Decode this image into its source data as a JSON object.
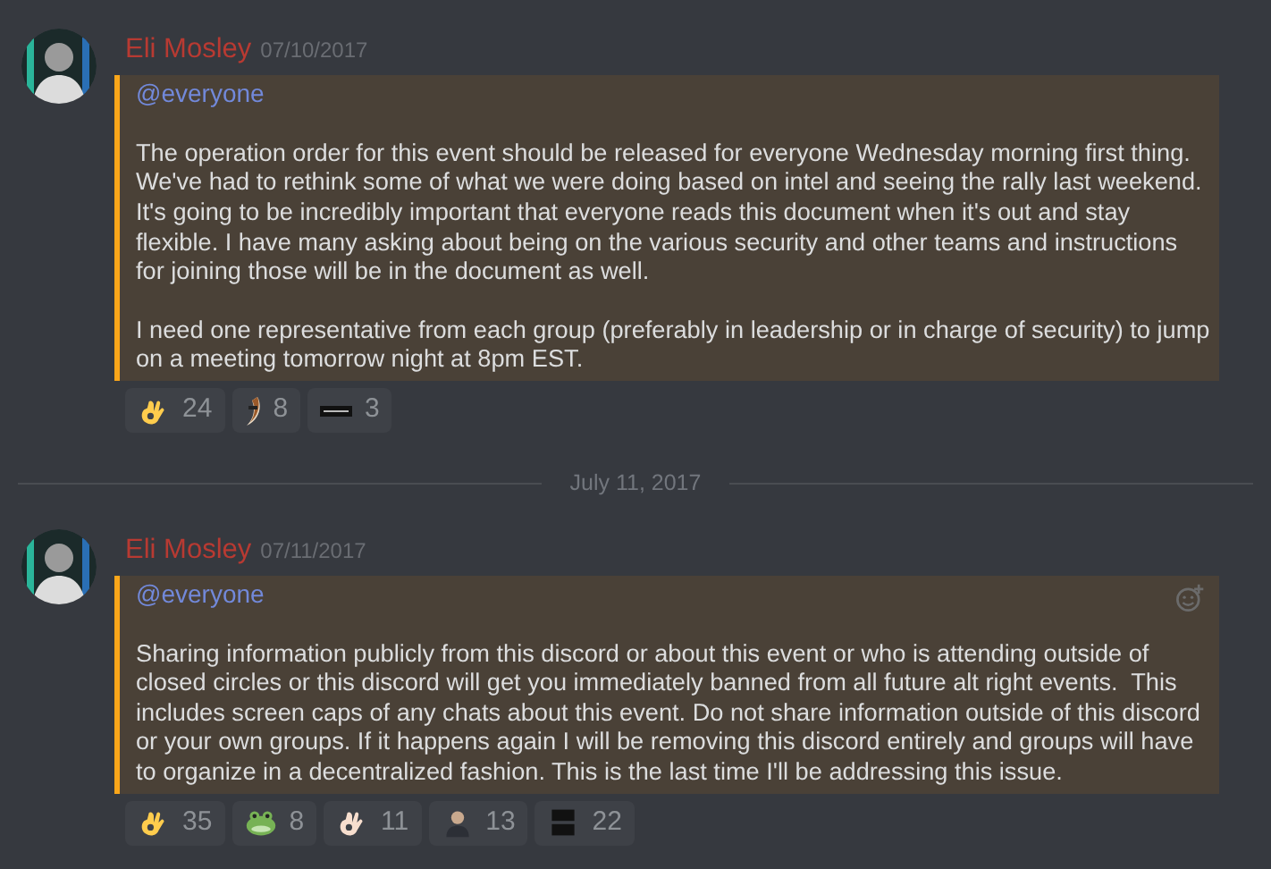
{
  "messages": [
    {
      "author": "Eli Mosley",
      "timestamp": "07/10/2017",
      "mentioned": true,
      "mention": "@everyone",
      "paragraphs": [
        "The operation order for this event should be released for everyone Wednesday morning first thing. We've had to rethink some of what we were doing based on intel and seeing the rally last weekend. It's going to be incredibly important that everyone reads this document when it's out and stay flexible. I have many asking about being on the various security and other teams and instructions for joining those will be in the document as well.",
        "I need one representative from each group (preferably in leadership or in charge of security) to jump on a meeting tomorrow night at 8pm EST."
      ],
      "reactions": [
        {
          "kind": "okhand",
          "count": "24"
        },
        {
          "kind": "blade",
          "count": "8"
        },
        {
          "kind": "tag",
          "count": "3"
        }
      ],
      "divider_after": "July 11, 2017"
    },
    {
      "author": "Eli Mosley",
      "timestamp": "07/11/2017",
      "mentioned": true,
      "add_reaction_shown": true,
      "mention": "@everyone",
      "paragraphs": [
        "Sharing information publicly from this discord or about this event or who is attending outside of closed circles or this discord will get you immediately banned from all future alt right events.  This includes screen caps of any chats about this event. Do not share information outside of this discord or your own groups. If it happens again I will be removing this discord entirely and groups will have to organize in a decentralized fashion. This is the last time I'll be addressing this issue."
      ],
      "reactions": [
        {
          "kind": "okhand",
          "count": "35"
        },
        {
          "kind": "frog",
          "count": "8"
        },
        {
          "kind": "okhandlight",
          "count": "11"
        },
        {
          "kind": "person",
          "count": "13"
        },
        {
          "kind": "sign",
          "count": "22"
        }
      ]
    }
  ]
}
